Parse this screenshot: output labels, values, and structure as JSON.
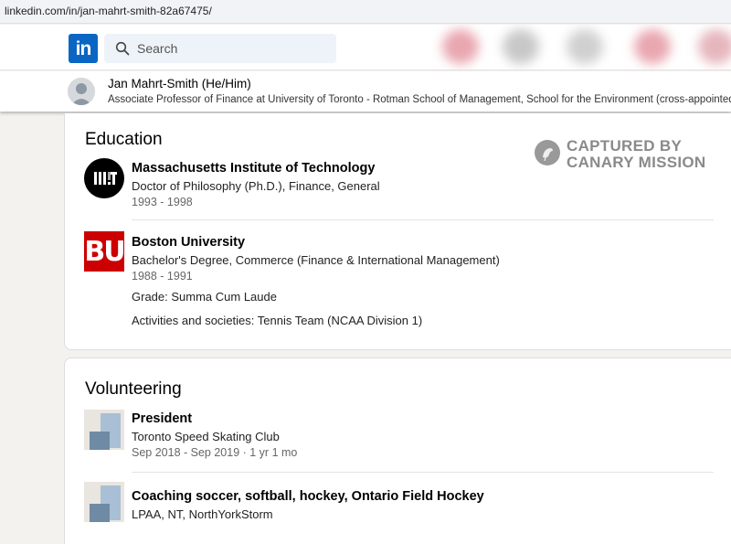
{
  "browser": {
    "url": "linkedin.com/in/jan-mahrt-smith-82a67475/"
  },
  "nav": {
    "logo": "in",
    "search_placeholder": "Search"
  },
  "profile": {
    "name": "Jan Mahrt-Smith (He/Him)",
    "headline": "Associate Professor of Finance at University of Toronto - Rotman School of Management, School for the Environment (cross-appointed)"
  },
  "watermark": {
    "line1": "CAPTURED BY",
    "line2": "CANARY MISSION"
  },
  "education": {
    "heading": "Education",
    "items": [
      {
        "school": "Massachusetts Institute of Technology",
        "degree": "Doctor of Philosophy (Ph.D.), Finance, General",
        "dates": "1993 - 1998",
        "logo_icon": "mit-logo-icon"
      },
      {
        "school": "Boston University",
        "degree": "Bachelor's Degree, Commerce (Finance & International Management)",
        "dates": "1988 - 1991",
        "grade": "Grade: Summa Cum Laude",
        "activities": "Activities and societies: Tennis Team (NCAA Division 1)",
        "logo_text": "BU",
        "logo_icon": "bu-logo-icon"
      }
    ]
  },
  "volunteering": {
    "heading": "Volunteering",
    "items": [
      {
        "role": "President",
        "org": "Toronto Speed Skating Club",
        "dates": "Sep 2018 - Sep 2019 · 1 yr 1 mo"
      },
      {
        "role": "Coaching soccer, softball, hockey, Ontario Field Hockey",
        "org": "LPAA, NT, NorthYorkStorm"
      }
    ]
  },
  "colors": {
    "linkedin_blue": "#0a66c2",
    "bu_red": "#cc0000"
  }
}
